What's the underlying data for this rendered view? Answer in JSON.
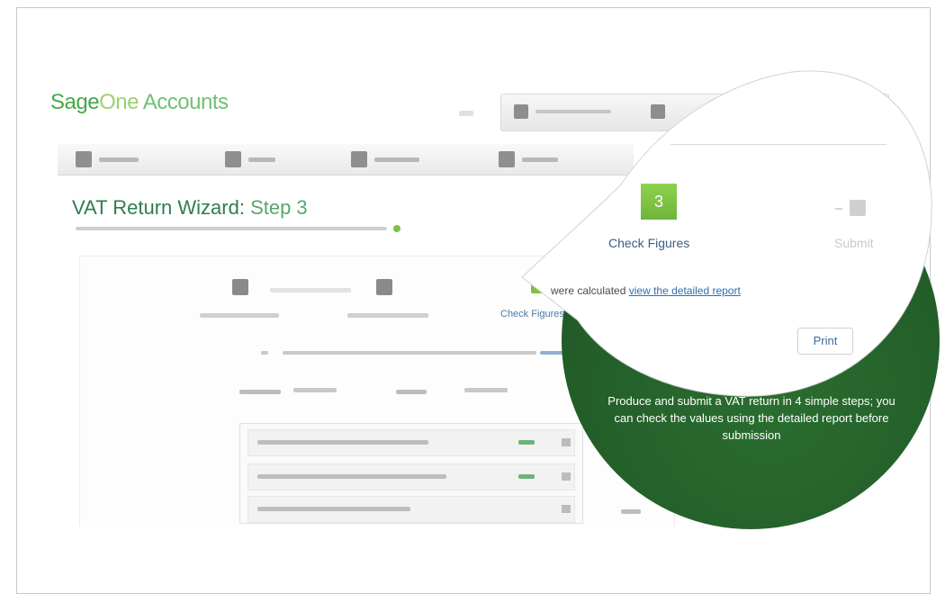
{
  "app": {
    "logo_sage": "Sage",
    "logo_one": "One",
    "logo_accounts": " Accounts"
  },
  "wizard": {
    "title": "VAT Return Wizard:",
    "step": " Step 3",
    "current_step_label": "Check Figures"
  },
  "callout": {
    "step_number": "3",
    "step_label": "Check Figures",
    "next_step_label": "Submit",
    "info_prefix": "were calculated",
    "info_link": "view the detailed report",
    "print_button": "Print",
    "description": "Produce and submit a VAT return in 4 simple steps; you can check the values using the detailed report before submission"
  },
  "colors": {
    "brand_green": "#45a84a",
    "accent_green": "#7cc243",
    "callout_green": "#245f2a",
    "link_blue": "#2e6fb0"
  },
  "icons": [
    "summary-icon",
    "sales-icon",
    "expenses-icon",
    "banking-icon",
    "user-icon",
    "settings-icon",
    "step-icon",
    "submit-icon"
  ]
}
